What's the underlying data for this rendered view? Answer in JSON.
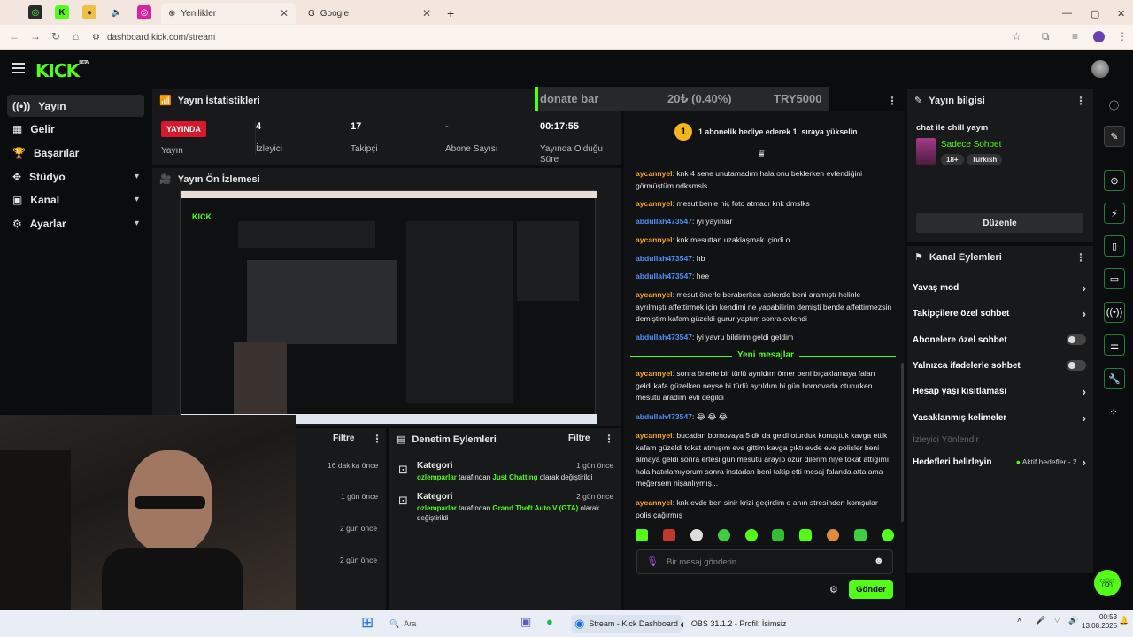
{
  "browser": {
    "tabs": [
      {
        "label": "Yenilikler"
      },
      {
        "label": "Google"
      }
    ],
    "url": "dashboard.kick.com/stream"
  },
  "brand": {
    "logo": "KICK",
    "beta": "BETA",
    "accent": "#53fc18"
  },
  "sidebar": {
    "items": [
      {
        "label": "Yayın",
        "icon": "broadcast-icon"
      },
      {
        "label": "Gelir",
        "icon": "grid-icon"
      },
      {
        "label": "Başarılar",
        "icon": "trophy-icon"
      },
      {
        "label": "Stüdyo",
        "icon": "studio-icon"
      },
      {
        "label": "Kanal",
        "icon": "channel-icon"
      },
      {
        "label": "Ayarlar",
        "icon": "gear-icon"
      }
    ]
  },
  "stats": {
    "title": "Yayın İstatistikleri",
    "live_badge": "YAYINDA",
    "items": [
      {
        "value": "",
        "label": "Yayın"
      },
      {
        "value": "4",
        "label": "İzleyici"
      },
      {
        "value": "17",
        "label": "Takipçi"
      },
      {
        "value": "-",
        "label": "Abone Sayısı"
      },
      {
        "value": "00:17:55",
        "label": "Yayında Olduğu Süre"
      }
    ]
  },
  "donate": {
    "title": "donate bar",
    "amount": "20₺ (0.40%)",
    "goal": "TRY5000",
    "progress_fraction": 0.004
  },
  "preview": {
    "title": "Yayın Ön İzlemesi"
  },
  "filters": {
    "left_label": "Filtre",
    "right_label": "Filtre",
    "log_title": "Denetim Eylemleri",
    "left_times": [
      "16 dakika önce",
      "1 gün önce",
      "2 gün önce",
      "2 gün önce"
    ],
    "entries": [
      {
        "title": "Kategori",
        "user": "ozlemparlar",
        "by": "tarafından",
        "game": "Just Chatting",
        "suffix": "olarak değiştirildi",
        "time": "1 gün önce"
      },
      {
        "title": "Kategori",
        "user": "ozlemparlar",
        "by": "tarafından",
        "game": "Grand Theft Auto V (GTA)",
        "suffix": "olarak değiştirildi",
        "time": "2 gün önce"
      }
    ]
  },
  "chat": {
    "gift_text": "1 abonelik hediye ederek 1. sıraya yükselin",
    "gift_rank": "1",
    "new_messages": "Yeni mesajlar",
    "input_placeholder": "Bir mesaj gönderin",
    "send": "Gönder",
    "messages": [
      {
        "user": "aycannyel",
        "text": "knk 4 sene unutamadım hala onu beklerken evlendiğini görmüştüm ndksmsls",
        "color": "orange"
      },
      {
        "user": "aycannyel",
        "text": "mesut benle hiç foto atmadı knk dmslks",
        "color": "orange"
      },
      {
        "user": "abdullah473547",
        "text": "iyi yayınlar",
        "color": "blue"
      },
      {
        "user": "aycannyel",
        "text": "knk mesuttan uzaklaşmak içindi o",
        "color": "orange"
      },
      {
        "user": "abdullah473547",
        "text": "hb",
        "color": "blue"
      },
      {
        "user": "abdullah473547",
        "text": "hee",
        "color": "blue"
      },
      {
        "user": "aycannyel",
        "text": "mesut önerle beraberken askerde beni aramıştı helinle ayrılmıştı affettirmek için kendimi ne yapabilirim demişti bende affettirmezsin demiştim kafam güzeldi gurur yaptım sonra evlendi",
        "color": "orange"
      },
      {
        "user": "abdullah473547",
        "text": "iyi yavru bildirim geldi geldim",
        "color": "blue"
      },
      {
        "user": "aycannyel",
        "text": "sonra önerle bir türlü ayrıldım ömer beni bıçaklamaya falan geldi kafa güzelken neyse bi türlü ayrıldım bi gün bornovada otururken mesutu aradım evli değildi",
        "color": "orange"
      },
      {
        "user": "abdullah473547",
        "text": "😂 😂 😂",
        "color": "blue"
      },
      {
        "user": "aycannyel",
        "text": "bucadan bornovaya 5 dk da geldi oturduk konuştuk kavga ettik kafam güzeldi tokat atmışım eve gittim kavga çıktı evde eve polisler beni almaya geldi sonra ertesi gün mesutu arayıp özür dilerim niye tokat attığımı hala hatırlamıyorum sonra instadan beni takip etti mesaj falanda atta ama meğersem nişanlıymış...",
        "color": "orange"
      },
      {
        "user": "aycannyel",
        "text": "knk evde ben sinir krizi geçirdim o anın stresinden komşular polis çağırmış",
        "color": "orange"
      }
    ]
  },
  "info": {
    "title": "Yayın bilgisi",
    "stream_title": "chat ile chill yayın",
    "category": "Sadece Sohbet",
    "tags": [
      "18+",
      "Turkish"
    ],
    "edit": "Düzenle"
  },
  "channel_actions": {
    "title": "Kanal Eylemleri",
    "items": [
      {
        "label": "Yavaş mod",
        "type": "arrow"
      },
      {
        "label": "Takipçilere özel sohbet",
        "type": "arrow"
      },
      {
        "label": "Abonelere özel sohbet",
        "type": "toggle"
      },
      {
        "label": "Yalnızca ifadelerle sohbet",
        "type": "toggle"
      },
      {
        "label": "Hesap yaşı kısıtlaması",
        "type": "arrow"
      },
      {
        "label": "Yasaklanmış kelimeler",
        "type": "arrow"
      },
      {
        "label": "İzleyici Yönlendir",
        "type": "disabled"
      },
      {
        "label": "Hedefleri belirleyin",
        "type": "arrow",
        "extra": "Aktif hedefler - 2"
      }
    ]
  },
  "taskbar": {
    "search": "Ara",
    "apps": [
      {
        "label": "Stream - Kick Dashboard"
      },
      {
        "label": "OBS 31.1.2 - Profil: İsimsiz"
      }
    ],
    "time": "00:53",
    "date": "13.08.2025"
  }
}
